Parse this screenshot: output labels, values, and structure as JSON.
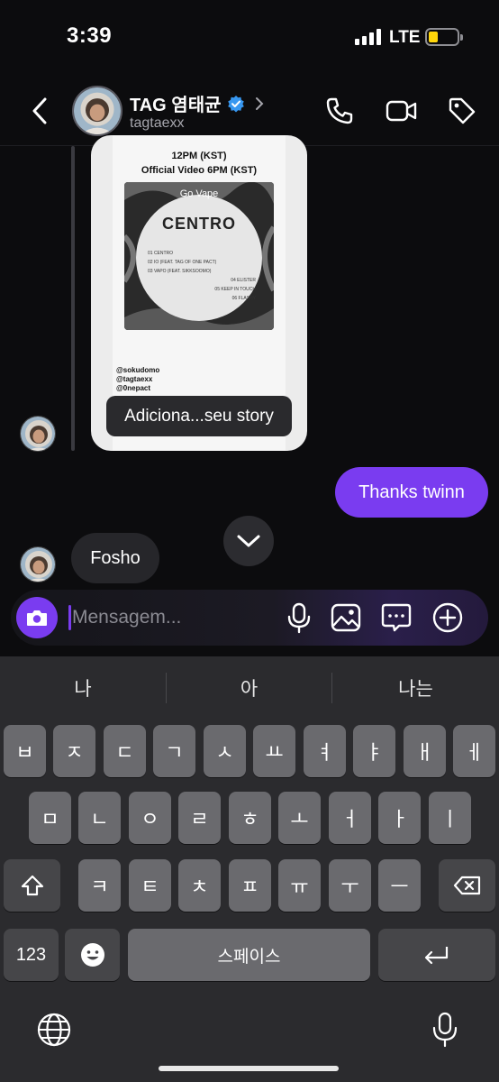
{
  "status": {
    "time": "3:39",
    "network": "LTE"
  },
  "header": {
    "name": "TAG 염태균",
    "handle": "tagtaexx"
  },
  "story": {
    "line1": "12PM (KST)",
    "line2": "Official Video 6PM (KST)",
    "cover_title": "CENTRO",
    "cover_watermark": "Go Vape",
    "tracks": [
      "01 CENTRO",
      "02 IO (FEAT. TAG OF ONE PACT)",
      "03 VAPO (FEAT. SIKKSOOMO)",
      "04 ELISTER",
      "05 KEEP IN TOUCH",
      "06 FLASHY"
    ],
    "credits": [
      "@sokudomo",
      "@tagtaexx",
      "@0nepact"
    ],
    "badge": "Adiciona...seu story"
  },
  "messages": {
    "outgoing": "Thanks twinn",
    "incoming": "Fosho"
  },
  "composer": {
    "placeholder": "Mensagem..."
  },
  "keyboard": {
    "suggestions": [
      "나",
      "아",
      "나는"
    ],
    "row1": [
      "ㅂ",
      "ㅈ",
      "ㄷ",
      "ㄱ",
      "ㅅ",
      "ㅛ",
      "ㅕ",
      "ㅑ",
      "ㅐ",
      "ㅔ"
    ],
    "row2": [
      "ㅁ",
      "ㄴ",
      "ㅇ",
      "ㄹ",
      "ㅎ",
      "ㅗ",
      "ㅓ",
      "ㅏ",
      "ㅣ"
    ],
    "row3": [
      "ㅋ",
      "ㅌ",
      "ㅊ",
      "ㅍ",
      "ㅠ",
      "ㅜ",
      "ㅡ"
    ],
    "numbers_key": "123",
    "space_key": "스페이스"
  },
  "colors": {
    "accent": "#7a3cf0",
    "background": "#0c0c0e",
    "verified": "#3797f0"
  },
  "icons": [
    "back-icon",
    "verified-icon",
    "chevron-right-icon",
    "phone-icon",
    "video-icon",
    "tag-icon",
    "chevron-down-icon",
    "camera-icon",
    "microphone-icon",
    "image-icon",
    "sticker-icon",
    "plus-icon",
    "shift-icon",
    "backspace-icon",
    "emoji-icon",
    "return-icon",
    "globe-icon",
    "dictation-icon"
  ]
}
